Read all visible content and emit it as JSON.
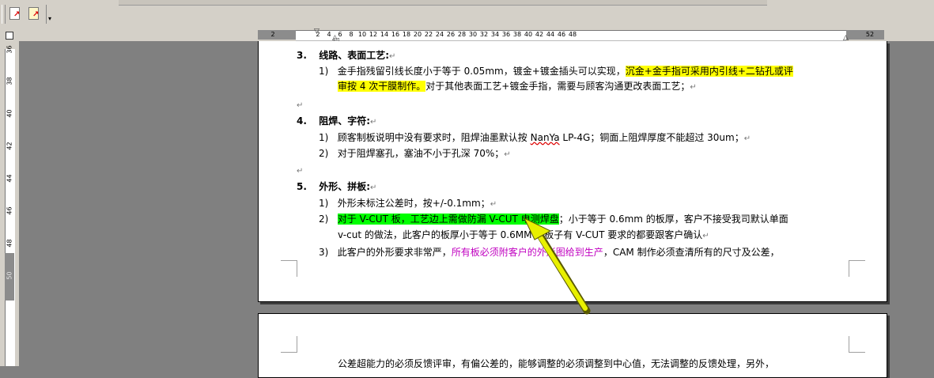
{
  "toolbar": {
    "buttons": [
      {
        "name": "pdf-convert-button",
        "glyph": "↗"
      },
      {
        "name": "pdf-options-button",
        "glyph": "↗"
      }
    ],
    "overflow_glyph": "▾"
  },
  "ruler_horizontal": {
    "left_labels": [
      "2"
    ],
    "labels": [
      "2",
      "4",
      "6",
      "8",
      "10",
      "12",
      "14",
      "16",
      "18",
      "20",
      "22",
      "24",
      "26",
      "28",
      "30",
      "32",
      "34",
      "36",
      "38",
      "40",
      "42",
      "44",
      "46",
      "48"
    ],
    "right_labels": [
      "52"
    ]
  },
  "ruler_vertical": {
    "labels": [
      "38",
      "40",
      "42",
      "44",
      "46",
      "48"
    ],
    "gray_labels": [
      "50"
    ],
    "top_label": "36"
  },
  "document": {
    "para_mark": "↵",
    "s3_heading_num": "3.",
    "s3_heading": "线路、表面工艺:",
    "s3_item1_num": "1)",
    "s3_item1_a": "金手指残留引线长度小于等于 0.05mm，镀金+镀金插头可以实现，",
    "s3_item1_hl": "沉金+金手指可采用内引线+二钻孔或评",
    "s3_item1_hl2": "审按 4 次干膜制作。",
    "s3_item1_b": "对于其他表面工艺+镀金手指，需要与顾客沟通更改表面工艺；",
    "s4_heading_num": "4.",
    "s4_heading": "阻焊、字符:",
    "s4_item1_num": "1)",
    "s4_item1_a": "顾客制板说明中没有要求时，阻焊油墨默认按 ",
    "s4_item1_sq": "NanYa",
    "s4_item1_b": " LP-4G；铜面上阻焊厚度不能超过 30um；",
    "s4_item2_num": "2)",
    "s4_item2": "对于阻焊塞孔，塞油不小于孔深 70%；",
    "s5_heading_num": "5.",
    "s5_heading": "外形、拼板:",
    "s5_item1_num": "1)",
    "s5_item1": "外形未标注公差时，按+/-0.1mm；",
    "s5_item2_num": "2)",
    "s5_item2_hl": "对于 V-CUT 板，工艺边上需做防漏 V-CUT 电测焊盘",
    "s5_item2_a": "；小于等于 0.6mm 的板厚，客户不接受我司默认单面",
    "s5_item2_b": "v-cut 的做法，此客户的板厚小于等于 0.6MM 的板子有 V-CUT 要求的都要跟客户确认",
    "s5_item3_num": "3)",
    "s5_item3_a": "此客户的外形要求非常严，",
    "s5_item3_mag": "所有板必须附客户的外形图给到生产",
    "s5_item3_b": "，CAM 制作必须查清所有的尺寸及公差，",
    "p2_line1": "公差超能力的必须反馈评审，有偏公差的，能够调整的必须调整到中心值，无法调整的反馈处理，另外，"
  },
  "colors": {
    "highlight_yellow": "#ffff00",
    "highlight_green": "#00ff00",
    "magenta_text": "#c000c0",
    "annotation_arrow": "#e8f000"
  }
}
